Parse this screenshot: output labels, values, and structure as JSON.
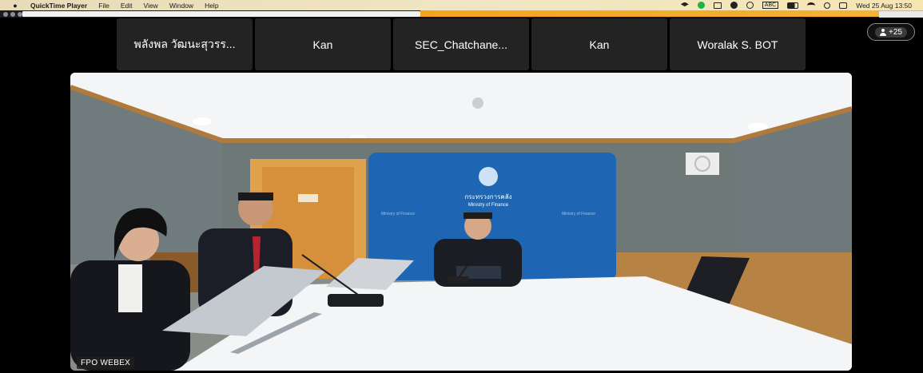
{
  "menubar": {
    "app_name": "QuickTime Player",
    "menus": [
      "File",
      "Edit",
      "View",
      "Window",
      "Help"
    ],
    "status_text": "ABC",
    "clock": "Wed 25 Aug 13:50"
  },
  "participants": [
    {
      "name": "พลังพล วัฒนะสุวรร..."
    },
    {
      "name": "Kan"
    },
    {
      "name": "SEC_Chatchane..."
    },
    {
      "name": "Kan"
    },
    {
      "name": "Woralak S. BOT"
    }
  ],
  "more_participants": {
    "label": "+25"
  },
  "video": {
    "speaker_label": "FPO WEBEX",
    "backdrop_title": "กระทรวงการคลัง",
    "backdrop_subtitle": "Ministry of Finance",
    "backdrop_small": "Ministry of Finance"
  },
  "colors": {
    "tile_bg": "#232323",
    "accent_orange": "#f4a31f",
    "backdrop_blue": "#1e66b4"
  }
}
